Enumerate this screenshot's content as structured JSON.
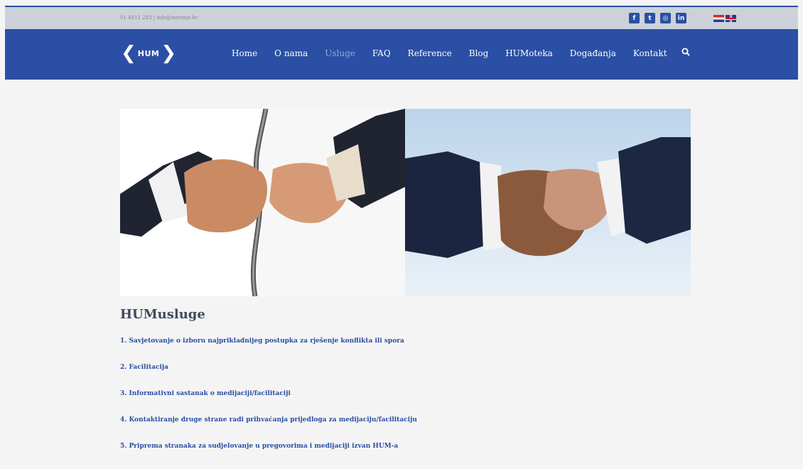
{
  "topbar": {
    "contact": "01 4811 283 | info@mirenje.hr",
    "socials": [
      {
        "icon": "facebook-icon",
        "glyph": "f"
      },
      {
        "icon": "twitter-icon",
        "glyph": "t"
      },
      {
        "icon": "instagram-icon",
        "glyph": "◎"
      },
      {
        "icon": "linkedin-icon",
        "glyph": "in"
      }
    ],
    "languages": [
      "hr-flag-icon",
      "uk-flag-icon"
    ]
  },
  "logo": {
    "text": "HUM"
  },
  "nav": {
    "items": [
      "Home",
      "O nama",
      "Usluge",
      "FAQ",
      "Reference",
      "Blog",
      "HUMoteka",
      "Događanja",
      "Kontakt"
    ],
    "active": "Usluge"
  },
  "colors": {
    "brand": "#2b4fa4",
    "topbar": "#cdd1d9",
    "heading": "#3e4a5f"
  },
  "content": {
    "heading": "HUMusluge",
    "items": [
      "1. Savjetovanje o izboru najprikladnijeg postupka za rješenje konflikta ili spora",
      "2. Facilitacija",
      "3. Informativni sastanak o medijaciji/facilitaciji",
      "4. Kontaktiranje druge strane radi prihvaćanja prijedloga za medijaciju/facilitaciju",
      "5. Priprema stranaka za sudjelovanje u pregovorima i medijaciji izvan HUM-a"
    ]
  }
}
